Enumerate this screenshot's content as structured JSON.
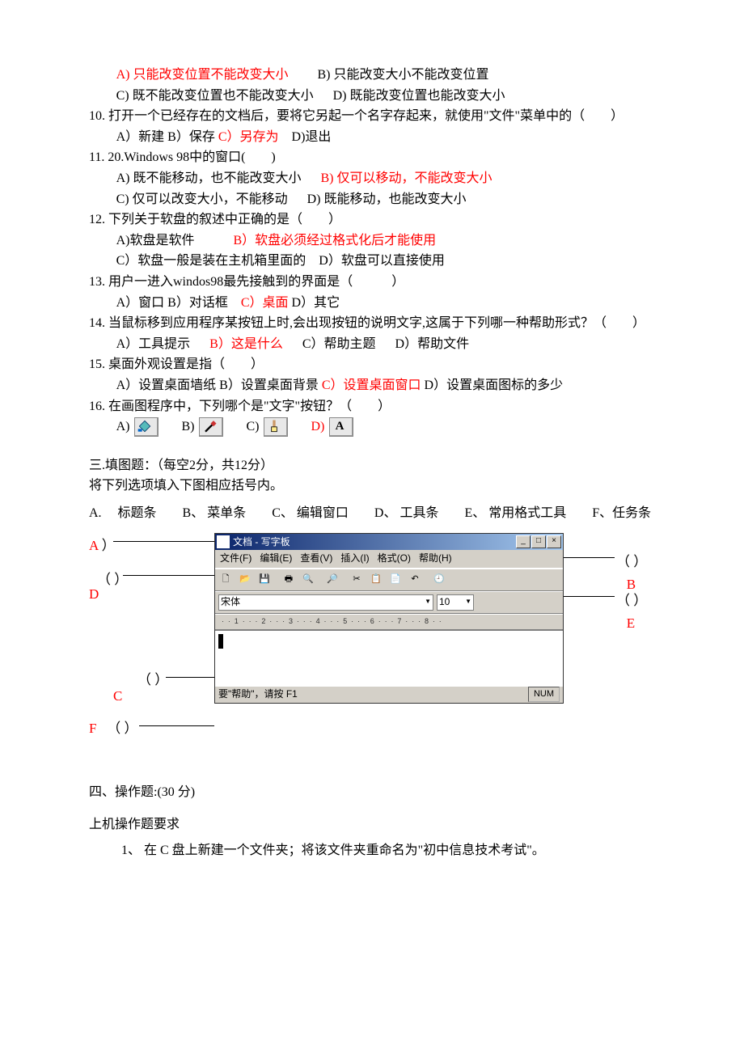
{
  "q9": {
    "a": "A) 只能改变位置不能改变大小",
    "b": "B) 只能改变大小不能改变位置",
    "c": "C) 既不能改变位置也不能改变大小",
    "d": "D) 既能改变位置也能改变大小"
  },
  "q10": {
    "stem": "10. 打开一个已经存在的文档后，要将它另起一个名字存起来，就使用\"文件\"菜单中的（　　）",
    "a": "A）新建",
    "b": "B）保存",
    "c": "C）另存为",
    "d": "D)退出"
  },
  "q11": {
    "stem": "11. 20.Windows 98中的窗口(　　)",
    "a": "A) 既不能移动，也不能改变大小",
    "b": "B) 仅可以移动，不能改变大小",
    "c": "C) 仅可以改变大小，不能移动",
    "d": "D) 既能移动，也能改变大小"
  },
  "q12": {
    "stem": "12. 下列关于软盘的叙述中正确的是（　　）",
    "a": "A)软盘是软件",
    "b": "B）软盘必须经过格式化后才能使用",
    "c": "C）软盘一般是装在主机箱里面的",
    "d": "D）软盘可以直接使用"
  },
  "q13": {
    "stem": "13. 用户一进入windos98最先接触到的界面是（　　　）",
    "a": "A）窗口",
    "b": "B）对话框",
    "c": "C）桌面",
    "d": "D）其它"
  },
  "q14": {
    "stem": "14. 当鼠标移到应用程序某按钮上时,会出现按钮的说明文字,这属于下列哪一种帮助形式？（　　）",
    "a": "A）工具提示",
    "b": "B）这是什么",
    "c": "C）帮助主题",
    "d": "D）帮助文件"
  },
  "q15": {
    "stem": "15. 桌面外观设置是指（　　）",
    "a": "A）设置桌面墙纸",
    "b": "B）设置桌面背景",
    "c": "C）设置桌面窗口",
    "d": "D）设置桌面图标的多少"
  },
  "q16": {
    "stem": "16. 在画图程序中，下列哪个是\"文字\"按钮？（　　）",
    "optA": "A)",
    "optB": "B)",
    "optC": "C)",
    "optD": "D)"
  },
  "section3": {
    "title": "三.填图题：（每空2分，共12分）",
    "instr": "将下列选项填入下图相应括号内。",
    "opts": "A. 　标题条　　B、 菜单条　　C、 编辑窗口　　D、 工具条　　E、 常用格式工具　　F、任务条"
  },
  "wordpad": {
    "title": "文档 - 写字板",
    "menu": {
      "file": "文件(F)",
      "edit": "编辑(E)",
      "view": "查看(V)",
      "insert": "插入(I)",
      "format": "格式(O)",
      "help": "帮助(H)"
    },
    "font": "宋体",
    "size": "10",
    "ruler": "· · 1 · · · 2 · · · 3 · · · 4 · · · 5 · · · 6 · · · 7 · · · 8 · ·",
    "status": "要\"帮助\"，请按 F1",
    "num": "NUM"
  },
  "labels": {
    "A": "A",
    "B": "B",
    "C": "C",
    "D": "D",
    "E": "E",
    "F": "F",
    "paren_open": "（",
    "paren_close": "）"
  },
  "section4": {
    "title": "四、操作题:(30 分)",
    "req": "上机操作题要求",
    "item1": "1、 在 C 盘上新建一个文件夹；将该文件夹重命名为\"初中信息技术考试\"。"
  }
}
